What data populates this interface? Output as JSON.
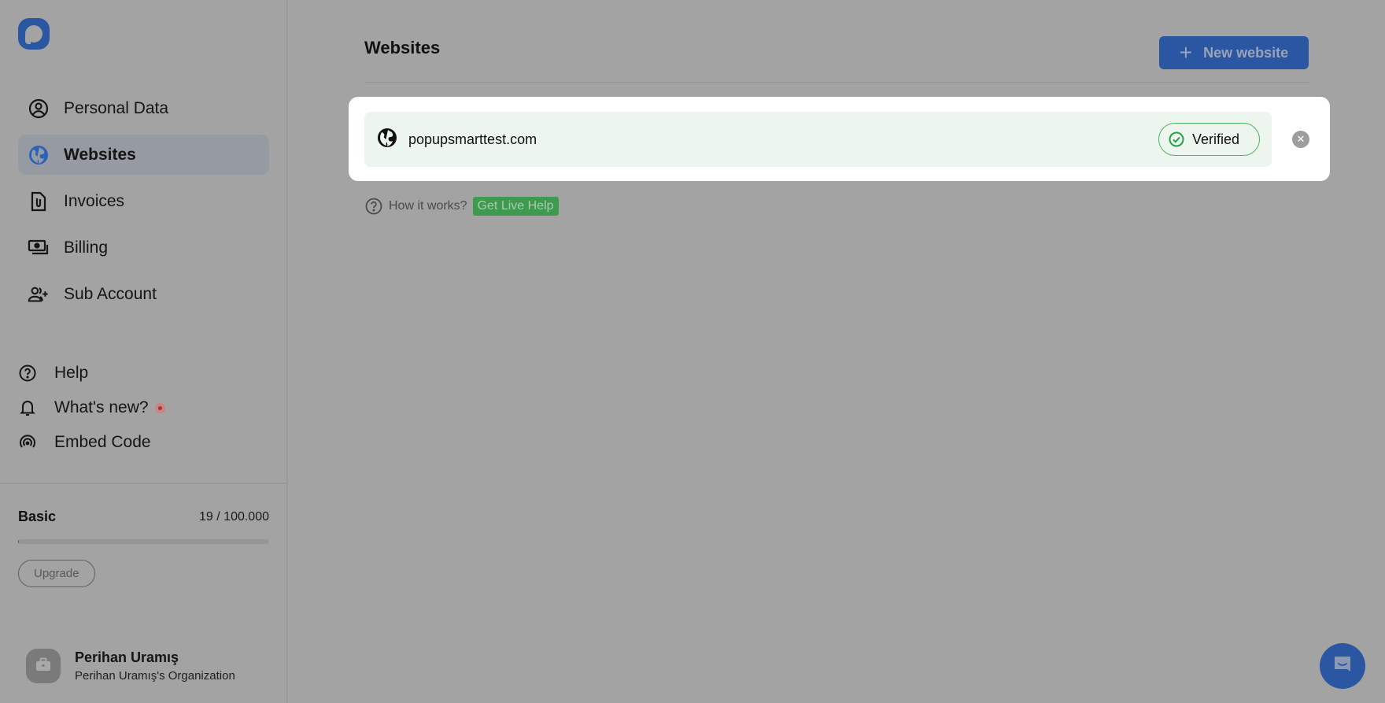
{
  "sidebar": {
    "logo": "popupsmart-logo",
    "nav": [
      {
        "label": "Personal Data",
        "icon": "user-circle-icon",
        "active": false
      },
      {
        "label": "Websites",
        "icon": "globe-icon",
        "active": true
      },
      {
        "label": "Invoices",
        "icon": "document-clip-icon",
        "active": false
      },
      {
        "label": "Billing",
        "icon": "money-icon",
        "active": false
      },
      {
        "label": "Sub Account",
        "icon": "user-add-icon",
        "active": false
      }
    ],
    "secondary": [
      {
        "label": "Help",
        "icon": "question-circle-icon"
      },
      {
        "label": "What's new?",
        "icon": "bell-icon",
        "badge": true
      },
      {
        "label": "Embed Code",
        "icon": "broadcast-icon"
      }
    ],
    "plan": {
      "name": "Basic",
      "usage_text": "19 / 100.000",
      "used": 19,
      "limit": 100000,
      "upgrade_label": "Upgrade"
    },
    "user": {
      "name": "Perihan Uramış",
      "organization": "Perihan Uramış's Organization",
      "avatar_icon": "briefcase-icon"
    }
  },
  "main": {
    "title": "Websites",
    "new_button_label": "New website",
    "websites": [
      {
        "domain": "popupsmarttest.com",
        "status": "Verified"
      }
    ],
    "help": {
      "text": "How it works?",
      "live_help_label": "Get Live Help"
    }
  },
  "colors": {
    "brand": "#2b56a2",
    "verified": "#4fb563",
    "live_help": "#3e9a4f",
    "overlay": "#a3a3a3"
  }
}
